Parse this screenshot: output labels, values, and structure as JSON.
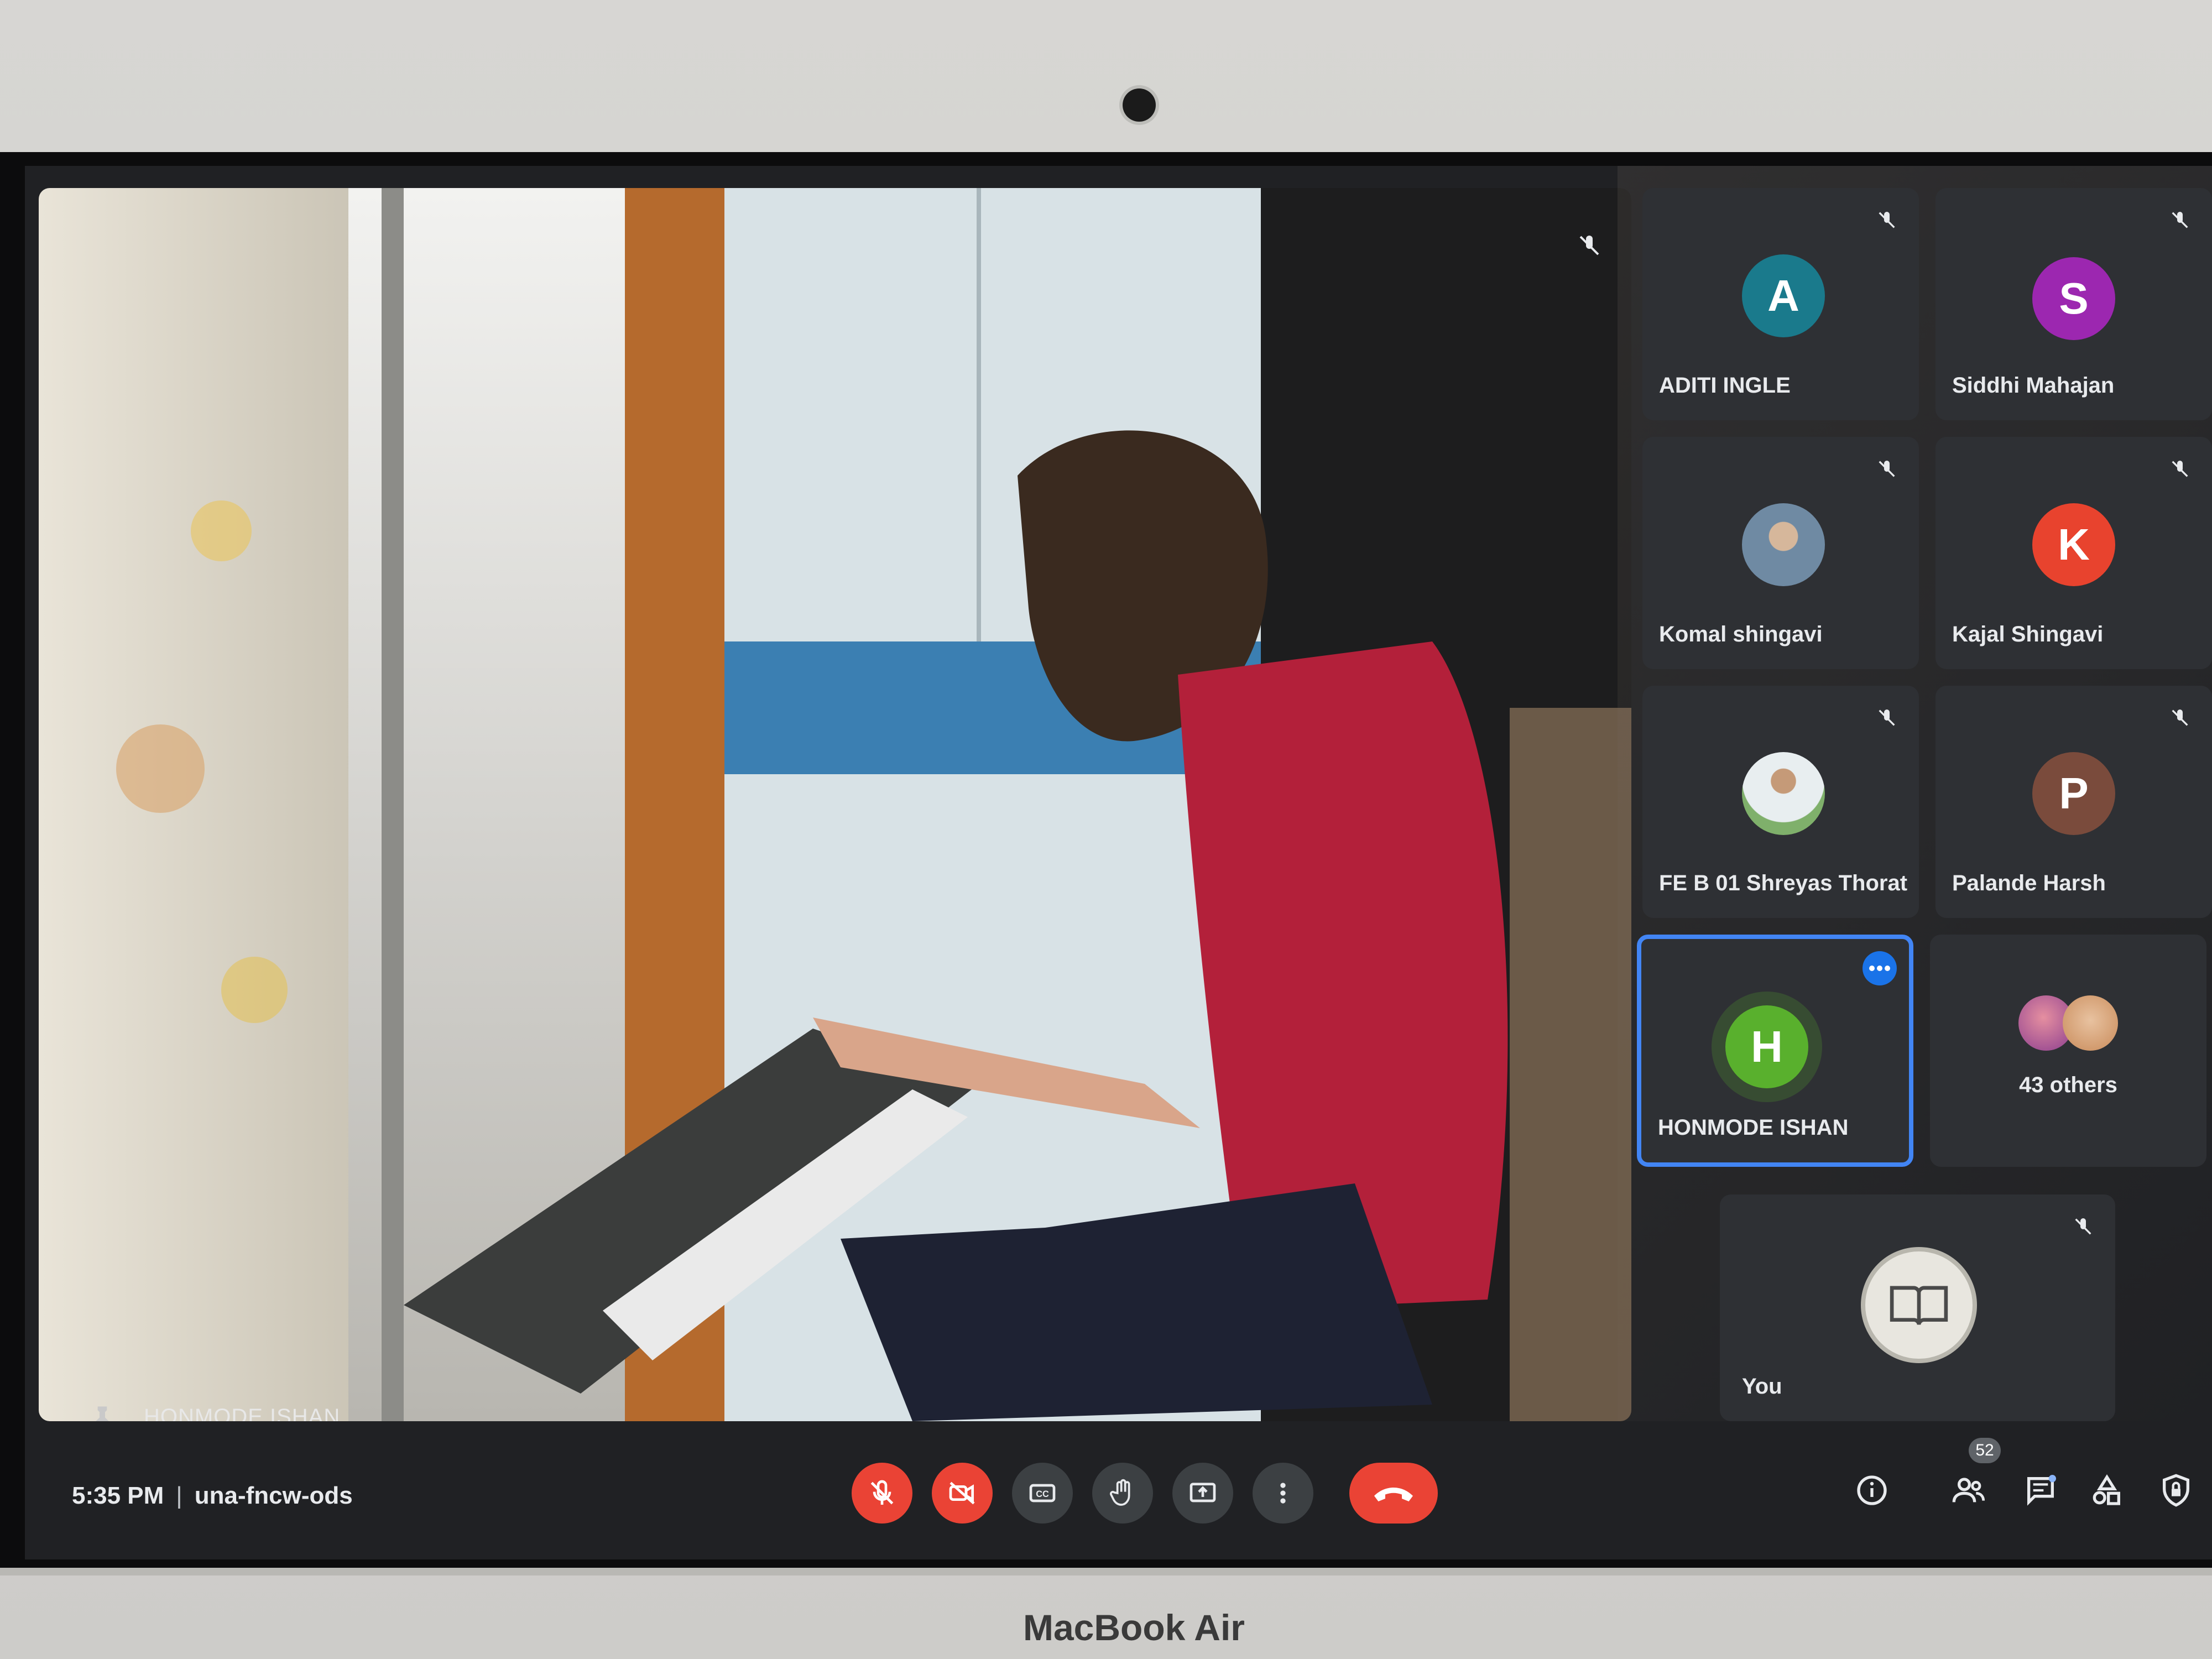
{
  "device": {
    "brand_label": "MacBook Air"
  },
  "meeting": {
    "time": "5:35 PM",
    "separator": "|",
    "code": "una-fncw-ods"
  },
  "main_tile": {
    "name": "HONMODE ISHAN"
  },
  "participants": [
    {
      "name": "ADITI INGLE",
      "initial": "A",
      "avatar_color": "#1a7a8c",
      "muted": true
    },
    {
      "name": "Siddhi Mahajan",
      "initial": "S",
      "avatar_color": "#9c27b0",
      "muted": true
    },
    {
      "name": "Komal shingavi",
      "initial": "",
      "avatar_color": "#8aa3b8",
      "muted": true
    },
    {
      "name": "Kajal Shingavi",
      "initial": "K",
      "avatar_color": "#e8432e",
      "muted": true
    },
    {
      "name": "FE B 01 Shreyas Thorat",
      "initial": "",
      "avatar_color": "#7fb06b",
      "muted": true
    },
    {
      "name": "Palande Harsh",
      "initial": "P",
      "avatar_color": "#7a4b3c",
      "muted": true
    },
    {
      "name": "HONMODE ISHAN",
      "initial": "H",
      "avatar_color": "#59b02d",
      "muted": false,
      "speaking": true
    },
    {
      "name": "43 others",
      "initial": "",
      "avatar_color": "#c98b5a",
      "muted": false
    }
  ],
  "self_tile": {
    "name": "You",
    "muted": true
  },
  "controls": {
    "people_count": "52",
    "buttons": [
      "mic-off",
      "camera-off",
      "captions",
      "raise-hand",
      "present",
      "more-options",
      "end-call"
    ],
    "right_buttons": [
      "meeting-details",
      "people",
      "chat",
      "activities",
      "host-controls"
    ]
  },
  "colors": {
    "mic_off": "#ea4335",
    "speaking_border": "#4285f4",
    "background": "#202124"
  }
}
